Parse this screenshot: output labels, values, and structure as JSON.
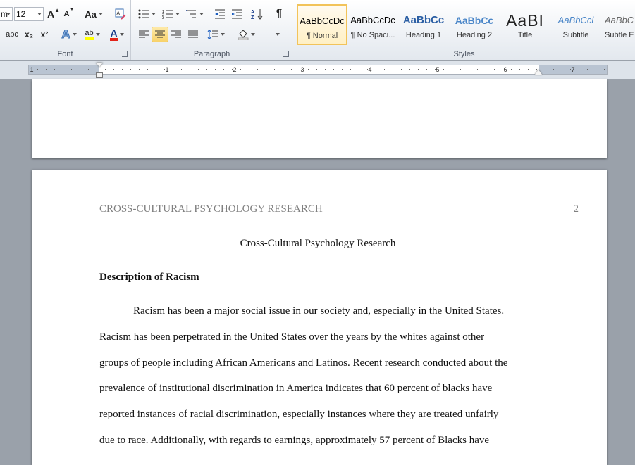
{
  "ribbon": {
    "font": {
      "font_name_partial": "m",
      "font_size": "12",
      "grow_label": "A",
      "shrink_label": "A",
      "change_case_label": "Aa",
      "strike_label": "abc",
      "subscript_label": "x₂",
      "superscript_label": "x²",
      "text_effects_label": "A",
      "highlight_label": "ab",
      "font_color_label": "A",
      "group_label": "Font",
      "highlight_color": "#ffff00",
      "font_color": "#e2231a"
    },
    "paragraph": {
      "group_label": "Paragraph",
      "show_marks_label": "¶",
      "sort_label": "A↓Z"
    },
    "styles": {
      "group_label": "Styles",
      "items": [
        {
          "sample": "AaBbCcDc",
          "name": "¶ Normal",
          "selected": true
        },
        {
          "sample": "AaBbCcDc",
          "name": "¶ No Spaci...",
          "selected": false
        },
        {
          "sample": "AaBbCc",
          "name": "Heading 1",
          "selected": false
        },
        {
          "sample": "AaBbCc",
          "name": "Heading 2",
          "selected": false
        },
        {
          "sample": "AaBI",
          "name": "Title",
          "selected": false
        },
        {
          "sample": "AaBbCcl",
          "name": "Subtitle",
          "selected": false
        },
        {
          "sample": "AaBbCc",
          "name": "Subtle E",
          "selected": false
        }
      ]
    }
  },
  "ruler": {
    "numbers": [
      "1",
      "1",
      "2",
      "3",
      "4",
      "5",
      "6",
      "7"
    ]
  },
  "document": {
    "running_head": "CROSS-CULTURAL PSYCHOLOGY RESEARCH",
    "page_number": "2",
    "title": "Cross-Cultural Psychology Research",
    "heading": "Description of Racism",
    "lines": [
      "Racism has been a major social issue in our society and, especially in the United States.",
      "Racism has been perpetrated in the United States over the years by the whites against other",
      "groups of people including African Americans and Latinos. Recent research conducted about the",
      "prevalence of institutional discrimination in America indicates that 60 percent of blacks have",
      "reported instances of racial discrimination, especially instances where they are treated unfairly",
      "due to race. Additionally, with regards to earnings, approximately 57 percent of Blacks have"
    ]
  }
}
